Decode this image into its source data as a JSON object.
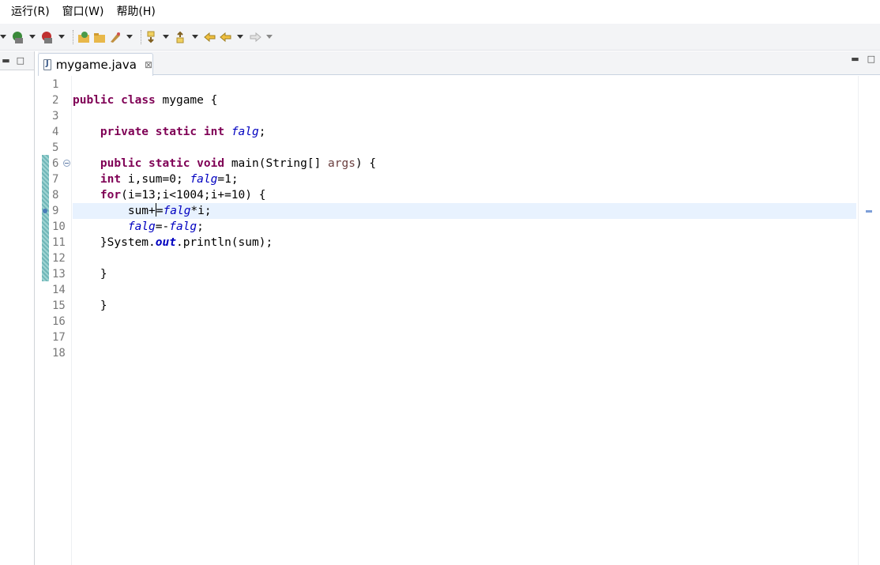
{
  "menu": [
    "运行(R)",
    "窗口(W)",
    "帮助(H)"
  ],
  "toolbar": {
    "icons": [
      "debug-icon",
      "run-icon",
      "coverage-icon",
      "open-type-icon",
      "open-folder-icon",
      "external-tools-icon",
      "next-annotation-icon",
      "prev-annotation-icon",
      "last-edit-icon",
      "back-icon",
      "forward-icon"
    ]
  },
  "colors": {
    "keyword": "#7f0055",
    "field": "#0000c0",
    "param": "#6a3e3e",
    "line_number": "#787878",
    "current_line": "#e8f2fe"
  },
  "editor": {
    "tab_title": "mygame.java",
    "tab_close": "⊠",
    "line_numbers": [
      "1",
      "2",
      "3",
      "4",
      "5",
      "6",
      "7",
      "8",
      "9",
      "10",
      "11",
      "12",
      "13",
      "14",
      "15",
      "16",
      "17",
      "18"
    ]
  }
}
